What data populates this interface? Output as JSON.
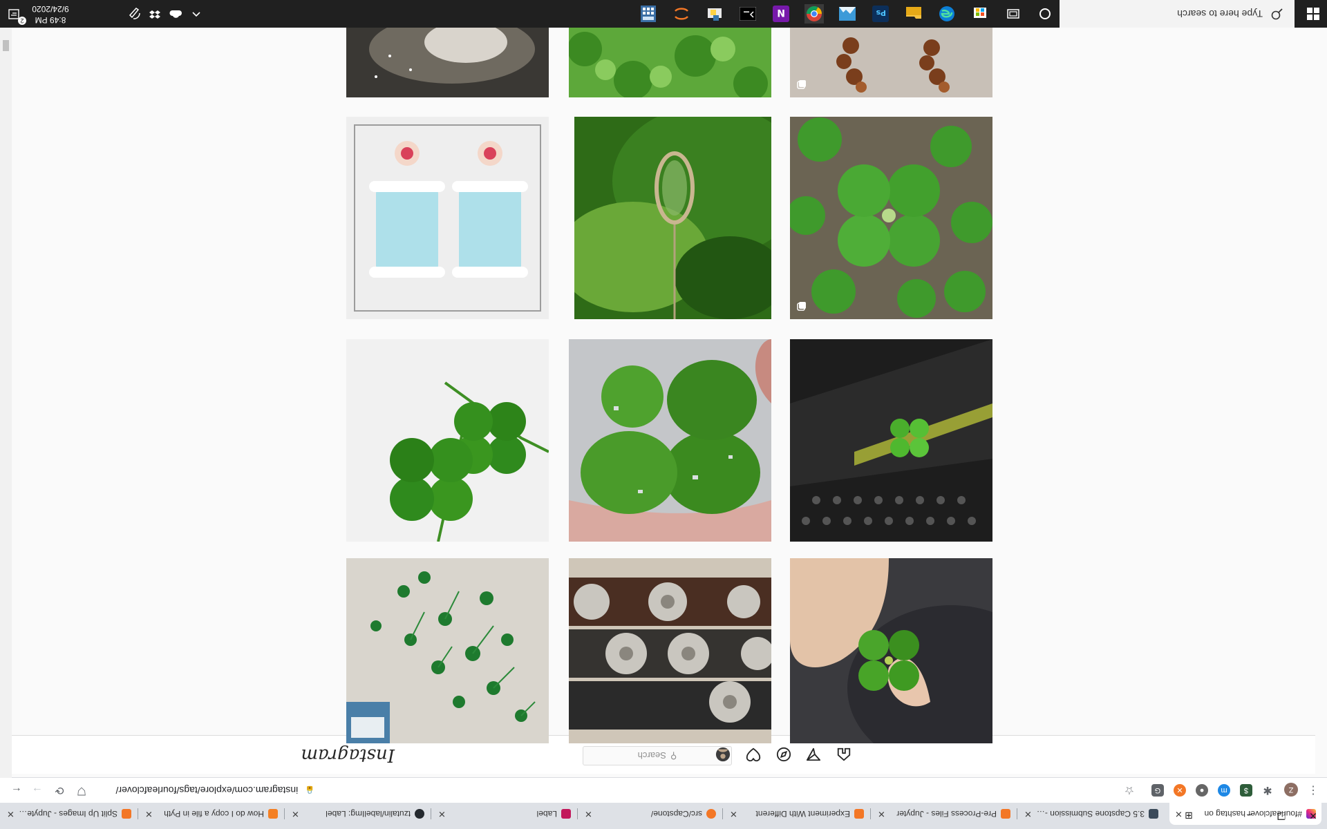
{
  "browser": {
    "tabs": [
      {
        "title": "#fourleafclover hashtag on",
        "active": true
      },
      {
        "title": "3.5 Capstone Submission - Jupyter",
        "active": false
      },
      {
        "title": "Pre-Process Files - Jupyter",
        "active": false
      },
      {
        "title": "Experiment With Different",
        "active": false
      },
      {
        "title": "src/Capstone/",
        "active": false
      },
      {
        "title": "Label",
        "active": false
      },
      {
        "title": "tzutalin/labelImg: Label",
        "active": false
      },
      {
        "title": "How do I copy a file in Pyth",
        "active": false
      },
      {
        "title": "Split Up Images - Jupyter N",
        "active": false
      }
    ],
    "url": "instagram.com/explore/tags/fourleafclover/"
  },
  "instagram": {
    "logo": "Instagram",
    "search_placeholder": "Search"
  },
  "taskbar": {
    "search_placeholder": "Type here to search",
    "time": "8:49 PM",
    "date": "9/24/2020",
    "notification_count": "2"
  },
  "colors": {
    "taskbar": "#202020",
    "tabbar": "#dee1e6",
    "clover_green": "#3b8a1f"
  }
}
